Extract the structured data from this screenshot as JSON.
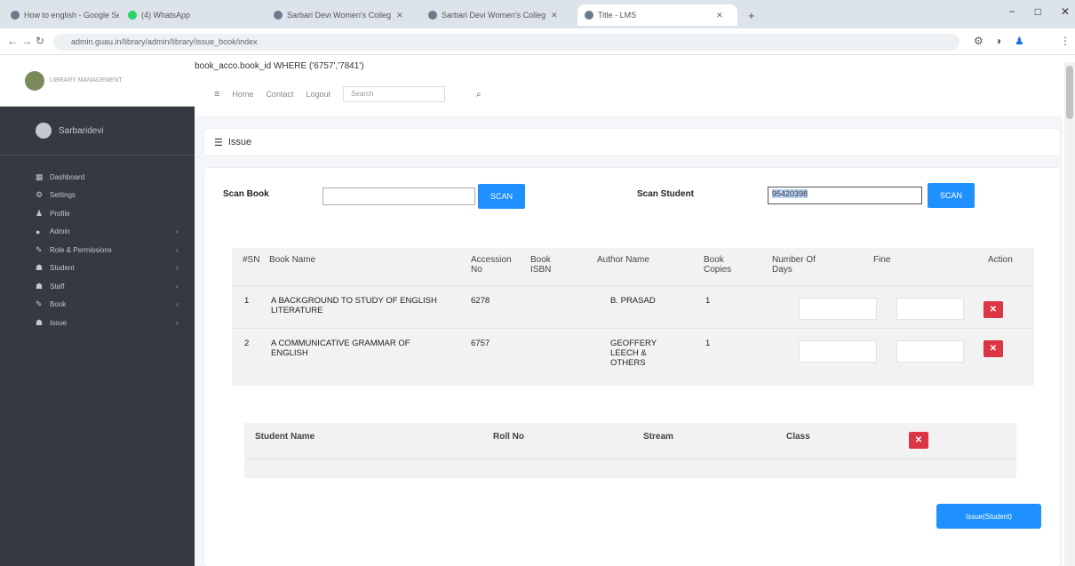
{
  "browser": {
    "tabs": [
      {
        "label": "How to english - Google Sear"
      },
      {
        "label": "(4) WhatsApp"
      },
      {
        "label": "Sarbari Devi Women's Colleg"
      },
      {
        "label": "Sarbari Devi Women's Colleg"
      },
      {
        "label": "Title - LMS"
      }
    ],
    "url": "admin.guau.in/library/admin/library/issue_book/index"
  },
  "header": {
    "query_text": "book_acco.book_id WHERE ('6757','7841')",
    "nav": {
      "home": "Home",
      "contact": "Contact",
      "logout": "Logout"
    },
    "search_placeholder": "Search"
  },
  "sidebar": {
    "brand": "LIBRARY MANAGEMENT",
    "user": "Sarbaridevi",
    "items": [
      {
        "label": "Dashboard",
        "icon": "dashboard-icon",
        "glyph": "▦"
      },
      {
        "label": "Settings",
        "icon": "cogs-icon",
        "glyph": "⚙"
      },
      {
        "label": "Profile",
        "icon": "user-icon",
        "glyph": "♟"
      },
      {
        "label": "Admin",
        "icon": "admin-icon",
        "glyph": "●"
      },
      {
        "label": "Role & Permissions",
        "icon": "key-icon",
        "glyph": "✎"
      },
      {
        "label": "Student",
        "icon": "users-icon",
        "glyph": "☗"
      },
      {
        "label": "Staff",
        "icon": "users-icon",
        "glyph": "☗"
      },
      {
        "label": "Book",
        "icon": "book-icon",
        "glyph": "✎"
      },
      {
        "label": "Issue",
        "icon": "users-icon",
        "glyph": "☗"
      }
    ]
  },
  "page": {
    "title": "Issue",
    "scan_book_label": "Scan Book",
    "scan_book_value": "",
    "scan_button": "SCAN",
    "scan_student_label": "Scan Student",
    "scan_student_value": "95420398",
    "book_table": {
      "headers": [
        "#SN",
        "Book Name",
        "Accession No",
        "Book ISBN",
        "Author Name",
        "Book Copies",
        "Number Of Days",
        "Fine",
        "Action"
      ],
      "rows": [
        {
          "sn": "1",
          "name": "A BACKGROUND TO STUDY OF ENGLISH LITERATURE",
          "accession": "6278",
          "isbn": "",
          "author": "B. PRASAD",
          "copies": "1"
        },
        {
          "sn": "2",
          "name": "A COMMUNICATIVE GRAMMAR OF ENGLISH",
          "accession": "6757",
          "isbn": "",
          "author": "GEOFFERY LEECH & OTHERS",
          "copies": "1"
        }
      ]
    },
    "student_table": {
      "headers": [
        "Student Name",
        "Roll No",
        "Stream",
        "Class"
      ]
    },
    "submit_label": "Issue(Student)"
  },
  "colors": {
    "primary": "#1e90ff",
    "danger": "#dc3545",
    "sidebar": "#343a40"
  }
}
